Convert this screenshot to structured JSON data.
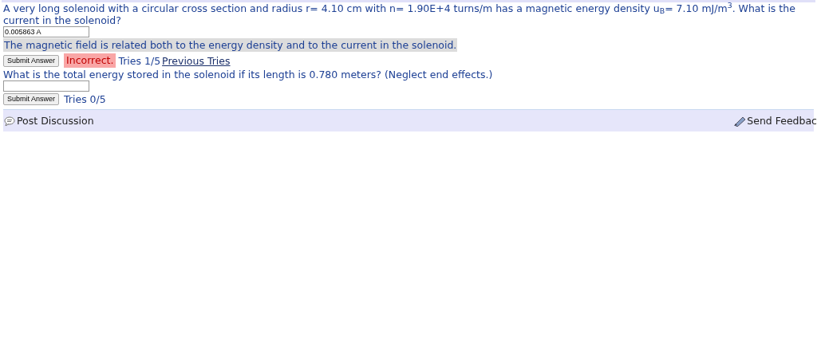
{
  "parts": [
    {
      "question": "A very long solenoid with a circular cross section and radius r= 4.10 cm with n= 1.90E+4 turns/m has a magnetic energy density u$_{B}$= 7.10 mJ/m$^{3}$. What is the current in the solenoid?",
      "answer": "0.005863 A",
      "hint": "The magnetic field is related both to the energy density and to the current in the solenoid.",
      "submit": "Submit Answer",
      "feedback": "Incorrect.",
      "tries": "Tries 1/5",
      "previous": "Previous Tries"
    },
    {
      "question": "What is the total energy stored in the solenoid if its length is 0.780 meters? (Neglect end effects.)",
      "submit": "Submit Answer",
      "tries": "Tries 0/5"
    }
  ],
  "footer": {
    "post": "Post Discussion",
    "feedback": "Send Feedbac"
  }
}
